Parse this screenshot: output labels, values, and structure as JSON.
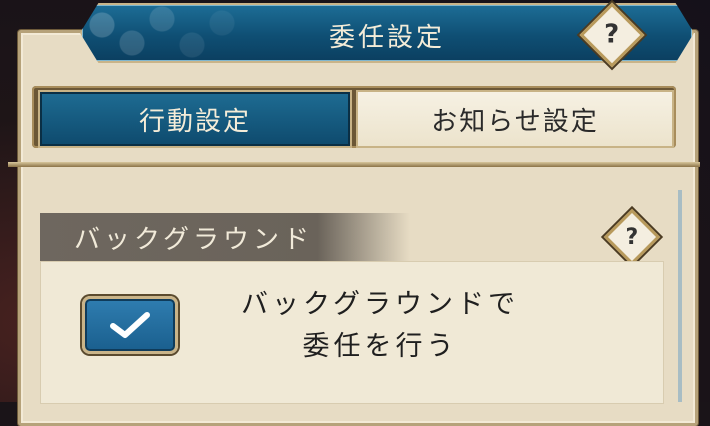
{
  "header": {
    "title": "委任設定"
  },
  "help": {
    "symbol": "?"
  },
  "tabs": [
    {
      "label": "行動設定",
      "active": true
    },
    {
      "label": "お知らせ設定",
      "active": false
    }
  ],
  "section": {
    "title": "バックグラウンド",
    "option": {
      "line1": "バックグラウンドで",
      "line2": "委任を行う",
      "checked": true
    }
  },
  "colors": {
    "header_blue": "#0f4f74",
    "panel_cream": "#e7dcc4",
    "gold_border": "#c9b489",
    "section_gray": "#6e675f"
  }
}
